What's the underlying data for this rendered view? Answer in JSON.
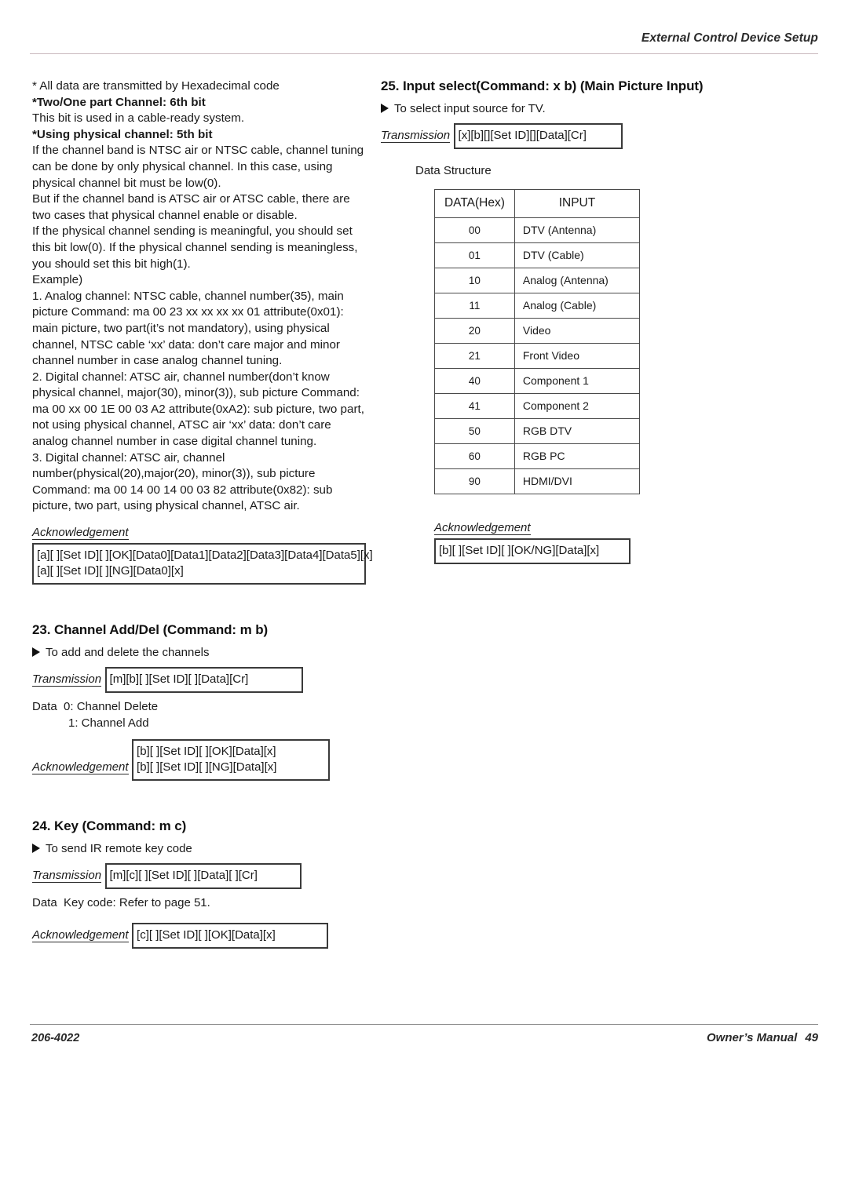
{
  "header": {
    "title": "External Control Device Setup"
  },
  "footer": {
    "doc_number": "206-4022",
    "manual_label": "Owner’s Manual",
    "page_number": "49"
  },
  "left_column": {
    "intro": {
      "note_hex": "* All data are transmitted by Hexadecimal code",
      "bold_two_one_part": "*Two/One part Channel: 6th bit",
      "line_cable_ready": "This bit is used in a cable-ready system.",
      "bold_using_physical": "*Using physical channel: 5th bit",
      "para1": "If the channel band is NTSC air or NTSC cable, channel tuning can be done by only physical channel. In this case, using physical channel bit must be low(0).",
      "para2": "But if the channel band is ATSC air or ATSC cable, there are two cases that physical channel enable or disable.",
      "para3": "If the physical channel sending is meaningful, you should set this bit low(0). If the physical channel sending is meaningless, you should set this bit high(1).",
      "example_label": "Example)",
      "example1": "1. Analog channel: NTSC cable, channel number(35), main picture Command: ma 00 23 xx xx xx xx 01 attribute(0x01): main picture, two part(it’s not mandatory), using physical channel, NTSC cable ‘xx’ data: don’t care major and minor channel number in case analog channel tuning.",
      "example2": "2. Digital channel: ATSC air, channel number(don’t know physical channel, major(30), minor(3)), sub picture Command: ma 00 xx 00 1E 00 03 A2 attribute(0xA2): sub picture, two part, not using physical channel, ATSC air ‘xx’ data: don’t care analog channel number in case digital channel tuning.",
      "example3": "3. Digital channel: ATSC air, channel number(physical(20),major(20), minor(3)), sub picture Command: ma 00 14 00 14 00 03 82 attribute(0x82): sub picture, two part, using physical channel, ATSC air."
    },
    "ack_top": {
      "label": "Acknowledgement",
      "line1": "[a][  ][Set ID][  ][OK][Data0][Data1][Data2][Data3][Data4][Data5][x]",
      "line2": "[a][  ][Set ID][  ][NG][Data0][x]"
    },
    "section23": {
      "heading": "23. Channel Add/Del (Command: m b)",
      "bullet": "To add and delete the channels",
      "transmission_label": "Transmission",
      "transmission_code": "[m][b][  ][Set ID][  ][Data][Cr]",
      "data_line1": "Data  0: Channel Delete",
      "data_line2": "1: Channel Add",
      "ack_label": "Acknowledgement",
      "ack_line1": "[b][  ][Set ID][  ][OK][Data][x]",
      "ack_line2": "[b][  ][Set ID][  ][NG][Data][x]"
    },
    "section24": {
      "heading": "24. Key (Command: m c)",
      "bullet": "To send IR remote key code",
      "transmission_label": "Transmission",
      "transmission_code": "[m][c][  ][Set ID][  ][Data][  ][Cr]",
      "data_line": "Data  Key code: Refer to page 51.",
      "ack_label": "Acknowledgement",
      "ack_line1": "[c][  ][Set ID][  ][OK][Data][x]"
    }
  },
  "right_column": {
    "section25": {
      "heading": "25. Input select(Command: x b) (Main Picture Input)",
      "bullet": "To select input source for TV.",
      "transmission_label": "Transmission",
      "transmission_code": "[x][b][][Set ID][][Data][Cr]",
      "data_structure_label": "Data Structure",
      "table": {
        "columns": [
          "DATA(Hex)",
          "INPUT"
        ],
        "rows": [
          [
            "00",
            "DTV (Antenna)"
          ],
          [
            "01",
            "DTV (Cable)"
          ],
          [
            "10",
            "Analog (Antenna)"
          ],
          [
            "11",
            "Analog (Cable)"
          ],
          [
            "20",
            "Video"
          ],
          [
            "21",
            "Front Video"
          ],
          [
            "40",
            "Component 1"
          ],
          [
            "41",
            "Component 2"
          ],
          [
            "50",
            "RGB DTV"
          ],
          [
            "60",
            "RGB PC"
          ],
          [
            "90",
            "HDMI/DVI"
          ]
        ]
      },
      "ack_label": "Acknowledgement",
      "ack_line1": "[b][  ][Set ID][  ][OK/NG][Data][x]"
    }
  }
}
